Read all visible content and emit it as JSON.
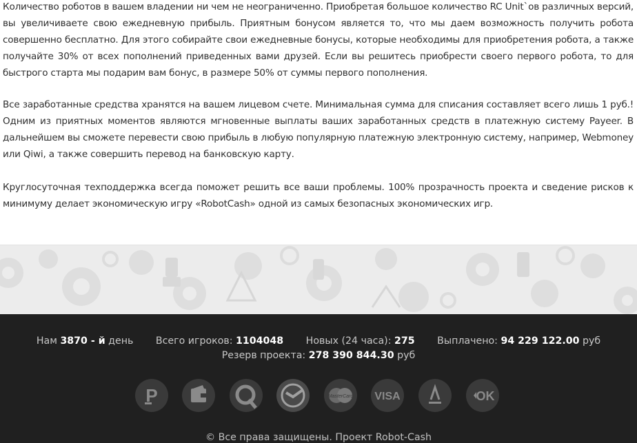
{
  "content": {
    "paragraphs": [
      "Количество роботов в вашем владении ни чем не неограниченно. Приобретая большое количество RC Unit`ов различных версий, вы увеличиваете свою ежедневную прибыль. Приятным бонусом является то, что мы даем возможность получить робота совершенно бесплатно. Для этого собирайте свои ежедневные бонусы, которые необходимы для приобретения робота, а также получайте 30% от всех пополнений приведенных вами друзей. Если вы решитесь приобрести своего первого робота, то для быстрого старта мы подарим вам бонус, в размере 50% от суммы первого пополнения.",
      "Все заработанные средства хранятся на вашем лицевом счете. Минимальная сумма для списания составляет всего лишь 1 руб.! Одним из приятных моментов являются мгновенные выплаты ваших заработанных средств в платежную систему Payeer. В дальнейшем вы сможете перевести свою прибыль в любую популярную платежную электронную систему, например, Webmoney или Qiwi, а также совершить перевод на банковскую карту.",
      "Круглосуточная техподдержка всегда поможет решить все ваши проблемы. 100% прозрачность проекта и сведение рисков к минимуму делает экономическую игру «RobotCash» одной из самых безопасных экономических игр."
    ]
  },
  "footer": {
    "day_prefix": "Нам",
    "day_value": "3870 - й",
    "day_suffix": "день",
    "players_label": "Всего игроков:",
    "players_value": "1104048",
    "new_label": "Новых (24 часа):",
    "new_value": "275",
    "paid_label": "Выплачено:",
    "paid_value": "94 229 122.00",
    "paid_unit": "руб",
    "reserve_label": "Резерв проекта:",
    "reserve_value": "278 390 844.30",
    "reserve_unit": "руб",
    "copyright": "© Все права защищены. Проект Robot-Cash",
    "payment_icons": [
      "payeer-icon",
      "wallet-icon",
      "qiwi-icon",
      "sberbank-icon",
      "mastercard-icon",
      "visa-icon",
      "alfabank-icon",
      "exmo-icon"
    ],
    "payment_texts": {
      "mastercard": "MasterCard",
      "visa": "VISA",
      "exmo": "OK"
    }
  },
  "colors": {
    "footer_bg": "#202020",
    "pattern_bg": "#ececec",
    "icon_bg": "#3a3a3a",
    "icon_fg": "#8a8a8a"
  }
}
